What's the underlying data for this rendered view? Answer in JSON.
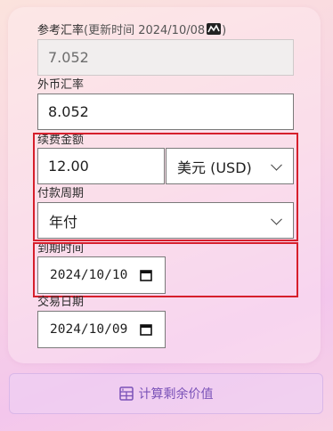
{
  "reference_rate": {
    "label": "参考汇率",
    "update_prefix": "(更新时间 2024/10/08",
    "update_suffix": ")",
    "value": "7.052",
    "icon": "chart-icon"
  },
  "foreign_rate": {
    "label": "外币汇率",
    "value": "8.052"
  },
  "renewal_amount": {
    "label": "续费金额",
    "value": "12.00",
    "currency": "美元 (USD)"
  },
  "payment_cycle": {
    "label": "付款周期",
    "value": "年付"
  },
  "expiry_date": {
    "label": "到期时间",
    "value": "2024/10/10"
  },
  "trade_date": {
    "label": "交易日期",
    "value": "2024/10/09"
  },
  "calculate_button": {
    "label": "计算剩余价值",
    "icon": "calculator-icon"
  },
  "colors": {
    "highlight": "#d61f2c",
    "button_text": "#7a52b8"
  }
}
